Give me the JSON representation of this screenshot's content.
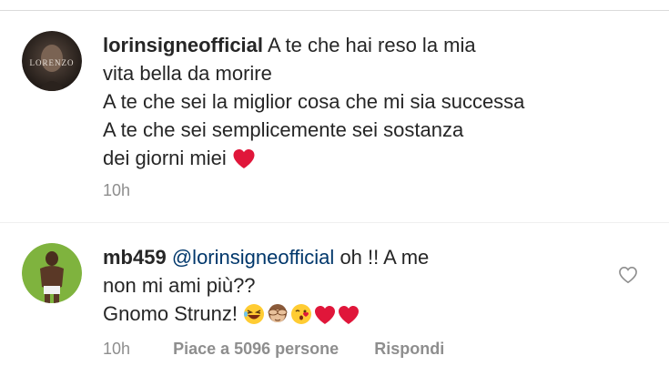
{
  "comments": [
    {
      "username": "lorinsigneofficial",
      "lines": [
        "A te che hai reso la mia",
        "vita bella da morire",
        "A te che sei la miglior cosa che mi sia successa",
        "A te che sei semplicemente sei sostanza",
        "dei giorni miei"
      ],
      "time": "10h",
      "avatar_text": "LORENZO"
    },
    {
      "username": "mb459",
      "mention": "@lorinsigneofficial",
      "lines": [
        "oh !! A me",
        "non mi ami più??",
        "Gnomo Strunz!"
      ],
      "time": "10h",
      "likes": "Piace a 5096 persone",
      "reply": "Rispondi"
    }
  ],
  "colors": {
    "text": "#262626",
    "mention": "#00376b",
    "meta": "#8e8e8e",
    "heart": "#ed4956"
  }
}
